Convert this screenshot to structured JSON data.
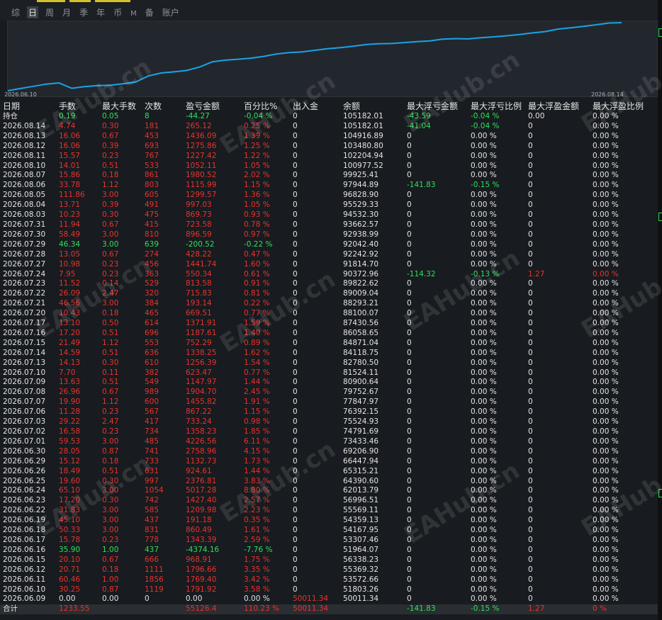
{
  "tabs": [
    "综",
    "日",
    "周",
    "月",
    "季",
    "年",
    "币",
    "M",
    "备",
    "账户"
  ],
  "active_tab": 1,
  "chart": {
    "x_start_label": "2026.06.10",
    "x_end_label": "2026.08.14",
    "line_color": "#1aa3e8",
    "balances": [
      50011.34,
      51803.26,
      53572.66,
      55369.32,
      56338.23,
      51964.07,
      53307.46,
      54167.95,
      54359.13,
      55569.11,
      56996.51,
      62013.79,
      64390.6,
      65315.21,
      66447.94,
      69206.9,
      73433.46,
      74791.69,
      75524.93,
      76392.15,
      77847.97,
      79752.67,
      80900.64,
      81524.11,
      82780.5,
      84118.75,
      84871.04,
      86058.65,
      87430.56,
      88100.07,
      88293.21,
      89009.04,
      89822.62,
      90372.96,
      91814.7,
      92242.92,
      92042.4,
      92938.99,
      93662.57,
      94532.3,
      95529.33,
      96828.9,
      97944.89,
      99925.41,
      100977.52,
      102204.94,
      103480.8,
      104916.89,
      105182.01
    ]
  },
  "table": {
    "headers": [
      "日期",
      "手数",
      "最大手数",
      "次数",
      "盈亏金额",
      "百分比%",
      "出入金",
      "余额",
      "最大浮亏金额",
      "最大浮亏比例",
      "最大浮盈金额",
      "最大浮盈比例"
    ],
    "holding": [
      "持仓",
      "0.19",
      "0.05",
      "8",
      "-44.27",
      "-0.04 %",
      "0",
      "105182.01",
      "-43.59",
      "-0.04 %",
      "0.00",
      "0.00 %"
    ],
    "rows": [
      [
        "2026.08.14",
        "4.74",
        "0.30",
        "181",
        "265.12",
        "0.25 %",
        "0",
        "105182.01",
        "-41.04",
        "-0.04 %",
        "0",
        "0.00 %"
      ],
      [
        "2026.08.13",
        "16.06",
        "0.67",
        "453",
        "1436.09",
        "1.39 %",
        "0",
        "104916.89",
        "0",
        "0.00 %",
        "0",
        "0.00 %"
      ],
      [
        "2026.08.12",
        "16.06",
        "0.39",
        "693",
        "1275.86",
        "1.25 %",
        "0",
        "103480.80",
        "0",
        "0.00 %",
        "0",
        "0.00 %"
      ],
      [
        "2026.08.11",
        "15.57",
        "0.23",
        "767",
        "1227.42",
        "1.22 %",
        "0",
        "102204.94",
        "0",
        "0.00 %",
        "0",
        "0.00 %"
      ],
      [
        "2026.08.10",
        "14.01",
        "0.51",
        "533",
        "1052.11",
        "1.05 %",
        "0",
        "100977.52",
        "0",
        "0.00 %",
        "0",
        "0.00 %"
      ],
      [
        "2026.08.07",
        "15.86",
        "0.18",
        "861",
        "1980.52",
        "2.02 %",
        "0",
        "99925.41",
        "0",
        "0.00 %",
        "0",
        "0.00 %"
      ],
      [
        "2026.08.06",
        "33.78",
        "1.12",
        "803",
        "1115.99",
        "1.15 %",
        "0",
        "97944.89",
        "-141.83",
        "-0.15 %",
        "0",
        "0.00 %"
      ],
      [
        "2026.08.05",
        "111.86",
        "3.00",
        "605",
        "1299.57",
        "1.36 %",
        "0",
        "96828.90",
        "0",
        "0.00 %",
        "0",
        "0.00 %"
      ],
      [
        "2026.08.04",
        "13.71",
        "0.39",
        "491",
        "997.03",
        "1.05 %",
        "0",
        "95529.33",
        "0",
        "0.00 %",
        "0",
        "0.00 %"
      ],
      [
        "2026.08.03",
        "10.23",
        "0.30",
        "475",
        "869.73",
        "0.93 %",
        "0",
        "94532.30",
        "0",
        "0.00 %",
        "0",
        "0.00 %"
      ],
      [
        "2026.07.31",
        "11.94",
        "0.67",
        "415",
        "723.58",
        "0.78 %",
        "0",
        "93662.57",
        "0",
        "0.00 %",
        "0",
        "0.00 %"
      ],
      [
        "2026.07.30",
        "58.49",
        "3.00",
        "810",
        "896.59",
        "0.97 %",
        "0",
        "92938.99",
        "0",
        "0.00 %",
        "0",
        "0.00 %"
      ],
      [
        "2026.07.29",
        "46.34",
        "3.00",
        "639",
        "-200.52",
        "-0.22 %",
        "0",
        "92042.40",
        "0",
        "0.00 %",
        "0",
        "0.00 %"
      ],
      [
        "2026.07.28",
        "13.05",
        "0.67",
        "274",
        "428.22",
        "0.47 %",
        "0",
        "92242.92",
        "0",
        "0.00 %",
        "0",
        "0.00 %"
      ],
      [
        "2026.07.27",
        "10.98",
        "0.23",
        "456",
        "1441.74",
        "1.60 %",
        "0",
        "91814.70",
        "0",
        "0.00 %",
        "0",
        "0.00 %"
      ],
      [
        "2026.07.24",
        "7.95",
        "0.23",
        "363",
        "550.34",
        "0.61 %",
        "0",
        "90372.96",
        "-114.32",
        "-0.13 %",
        "1.27",
        "0.00 %"
      ],
      [
        "2026.07.23",
        "11.52",
        "0.14",
        "529",
        "813.58",
        "0.91 %",
        "0",
        "89822.62",
        "0",
        "0.00 %",
        "0",
        "0.00 %"
      ],
      [
        "2026.07.22",
        "26.09",
        "2.47",
        "320",
        "715.83",
        "0.81 %",
        "0",
        "89009.04",
        "0",
        "0.00 %",
        "0",
        "0.00 %"
      ],
      [
        "2026.07.21",
        "46.56",
        "3.00",
        "384",
        "193.14",
        "0.22 %",
        "0",
        "88293.21",
        "0",
        "0.00 %",
        "0",
        "0.00 %"
      ],
      [
        "2026.07.20",
        "10.43",
        "0.18",
        "465",
        "669.51",
        "0.77 %",
        "0",
        "88100.07",
        "0",
        "0.00 %",
        "0",
        "0.00 %"
      ],
      [
        "2026.07.17",
        "13.10",
        "0.50",
        "614",
        "1371.91",
        "1.59 %",
        "0",
        "87430.56",
        "0",
        "0.00 %",
        "0",
        "0.00 %"
      ],
      [
        "2026.07.16",
        "17.20",
        "0.51",
        "696",
        "1187.61",
        "1.40 %",
        "0",
        "86058.65",
        "0",
        "0.00 %",
        "0",
        "0.00 %"
      ],
      [
        "2026.07.15",
        "21.49",
        "1.12",
        "553",
        "752.29",
        "0.89 %",
        "0",
        "84871.04",
        "0",
        "0.00 %",
        "0",
        "0.00 %"
      ],
      [
        "2026.07.14",
        "14.59",
        "0.51",
        "636",
        "1338.25",
        "1.62 %",
        "0",
        "84118.75",
        "0",
        "0.00 %",
        "0",
        "0.00 %"
      ],
      [
        "2026.07.13",
        "14.13",
        "0.30",
        "610",
        "1256.39",
        "1.54 %",
        "0",
        "82780.50",
        "0",
        "0.00 %",
        "0",
        "0.00 %"
      ],
      [
        "2026.07.10",
        "7.70",
        "0.11",
        "382",
        "623.47",
        "0.77 %",
        "0",
        "81524.11",
        "0",
        "0.00 %",
        "0",
        "0.00 %"
      ],
      [
        "2026.07.09",
        "13.63",
        "0.51",
        "549",
        "1147.97",
        "1.44 %",
        "0",
        "80900.64",
        "0",
        "0.00 %",
        "0",
        "0.00 %"
      ],
      [
        "2026.07.08",
        "26.96",
        "0.67",
        "989",
        "1904.70",
        "2.45 %",
        "0",
        "79752.67",
        "0",
        "0.00 %",
        "0",
        "0.00 %"
      ],
      [
        "2026.07.07",
        "19.90",
        "1.12",
        "600",
        "1455.82",
        "1.91 %",
        "0",
        "77847.97",
        "0",
        "0.00 %",
        "0",
        "0.00 %"
      ],
      [
        "2026.07.06",
        "11.28",
        "0.23",
        "567",
        "867.22",
        "1.15 %",
        "0",
        "76392.15",
        "0",
        "0.00 %",
        "0",
        "0.00 %"
      ],
      [
        "2026.07.03",
        "29.22",
        "2.47",
        "417",
        "733.24",
        "0.98 %",
        "0",
        "75524.93",
        "0",
        "0.00 %",
        "0",
        "0.00 %"
      ],
      [
        "2026.07.02",
        "16.58",
        "0.23",
        "734",
        "1358.23",
        "1.85 %",
        "0",
        "74791.69",
        "0",
        "0.00 %",
        "0",
        "0.00 %"
      ],
      [
        "2026.07.01",
        "59.53",
        "3.00",
        "485",
        "4226.56",
        "6.11 %",
        "0",
        "73433.46",
        "0",
        "0.00 %",
        "0",
        "0.00 %"
      ],
      [
        "2026.06.30",
        "28.05",
        "0.87",
        "741",
        "2758.96",
        "4.15 %",
        "0",
        "69206.90",
        "0",
        "0.00 %",
        "0",
        "0.00 %"
      ],
      [
        "2026.06.29",
        "15.12",
        "0.18",
        "733",
        "1132.73",
        "1.73 %",
        "0",
        "66447.94",
        "0",
        "0.00 %",
        "0",
        "0.00 %"
      ],
      [
        "2026.06.26",
        "18.49",
        "0.51",
        "631",
        "924.61",
        "1.44 %",
        "0",
        "65315.21",
        "0",
        "0.00 %",
        "0",
        "0.00 %"
      ],
      [
        "2026.06.25",
        "19.60",
        "0.30",
        "997",
        "2376.81",
        "3.83 %",
        "0",
        "64390.60",
        "0",
        "0.00 %",
        "0",
        "0.00 %"
      ],
      [
        "2026.06.24",
        "65.10",
        "3.00",
        "1054",
        "5017.28",
        "8.80 %",
        "0",
        "62013.79",
        "0",
        "0.00 %",
        "0",
        "0.00 %"
      ],
      [
        "2026.06.23",
        "17.20",
        "0.30",
        "742",
        "1427.40",
        "2.57 %",
        "0",
        "56996.51",
        "0",
        "0.00 %",
        "0",
        "0.00 %"
      ],
      [
        "2026.06.22",
        "31.83",
        "3.00",
        "585",
        "1209.98",
        "2.23 %",
        "0",
        "55569.11",
        "0",
        "0.00 %",
        "0",
        "0.00 %"
      ],
      [
        "2026.06.19",
        "45.10",
        "3.00",
        "437",
        "191.18",
        "0.35 %",
        "0",
        "54359.13",
        "0",
        "0.00 %",
        "0",
        "0.00 %"
      ],
      [
        "2026.06.18",
        "50.33",
        "3.00",
        "831",
        "860.49",
        "1.61 %",
        "0",
        "54167.95",
        "0",
        "0.00 %",
        "0",
        "0.00 %"
      ],
      [
        "2026.06.17",
        "15.78",
        "0.23",
        "778",
        "1343.39",
        "2.59 %",
        "0",
        "53307.46",
        "0",
        "0.00 %",
        "0",
        "0.00 %"
      ],
      [
        "2026.06.16",
        "35.90",
        "1.00",
        "437",
        "-4374.16",
        "-7.76 %",
        "0",
        "51964.07",
        "0",
        "0.00 %",
        "0",
        "0.00 %"
      ],
      [
        "2026.06.15",
        "20.10",
        "0.67",
        "666",
        "968.91",
        "1.75 %",
        "0",
        "56338.23",
        "0",
        "0.00 %",
        "0",
        "0.00 %"
      ],
      [
        "2026.06.12",
        "20.71",
        "0.18",
        "1111",
        "1796.66",
        "3.35 %",
        "0",
        "55369.32",
        "0",
        "0.00 %",
        "0",
        "0.00 %"
      ],
      [
        "2026.06.11",
        "60.46",
        "1.00",
        "1856",
        "1769.40",
        "3.42 %",
        "0",
        "53572.66",
        "0",
        "0.00 %",
        "0",
        "0.00 %"
      ],
      [
        "2026.06.10",
        "30.25",
        "0.87",
        "1119",
        "1791.92",
        "3.58 %",
        "0",
        "51803.26",
        "0",
        "0.00 %",
        "0",
        "0.00 %"
      ],
      [
        "2026.06.09",
        "0.00",
        "0.00",
        "0",
        "0.00",
        "0.00 %",
        "50011.34",
        "50011.34",
        "0",
        "0.00 %",
        "0",
        "0.00 %"
      ]
    ],
    "total": [
      "合计",
      "1233.55",
      "",
      "",
      "55126.4",
      "110.23 %",
      "50011.34",
      "",
      "-141.83",
      "-0.15 %",
      "1.27",
      "0 %"
    ]
  },
  "watermark_text": "EAHub.cn",
  "colors": {
    "profit": "#e8332d",
    "loss": "#2ee05a",
    "neutral": "#e4e4e4",
    "line": "#1aa3e8"
  }
}
